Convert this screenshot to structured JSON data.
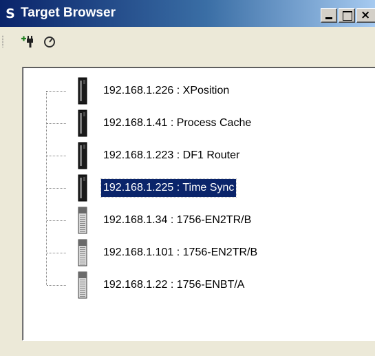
{
  "window": {
    "title": "Target Browser",
    "app_icon_glyph": "S",
    "min_glyph": "_",
    "close_glyph": "×"
  },
  "toolbar": {
    "buttons": [
      {
        "name": "add-target-icon"
      },
      {
        "name": "refresh-icon"
      }
    ]
  },
  "tree": {
    "items": [
      {
        "label": "192.168.1.226 : XPosition",
        "icon": "dark-device-icon",
        "selected": false
      },
      {
        "label": "192.168.1.41 : Process Cache",
        "icon": "dark-device-icon",
        "selected": false
      },
      {
        "label": "192.168.1.223 : DF1 Router",
        "icon": "dark-device-icon",
        "selected": false
      },
      {
        "label": "192.168.1.225 : Time Sync",
        "icon": "dark-device-icon",
        "selected": true
      },
      {
        "label": "192.168.1.34 : 1756-EN2TR/B",
        "icon": "light-device-icon",
        "selected": false
      },
      {
        "label": "192.168.1.101 : 1756-EN2TR/B",
        "icon": "light-device-icon",
        "selected": false
      },
      {
        "label": "192.168.1.22 : 1756-ENBT/A",
        "icon": "light-device-icon",
        "selected": false
      }
    ]
  },
  "colors": {
    "selection_bg": "#0a246a",
    "titlebar_start": "#0a246a",
    "titlebar_end": "#a6caf0"
  }
}
